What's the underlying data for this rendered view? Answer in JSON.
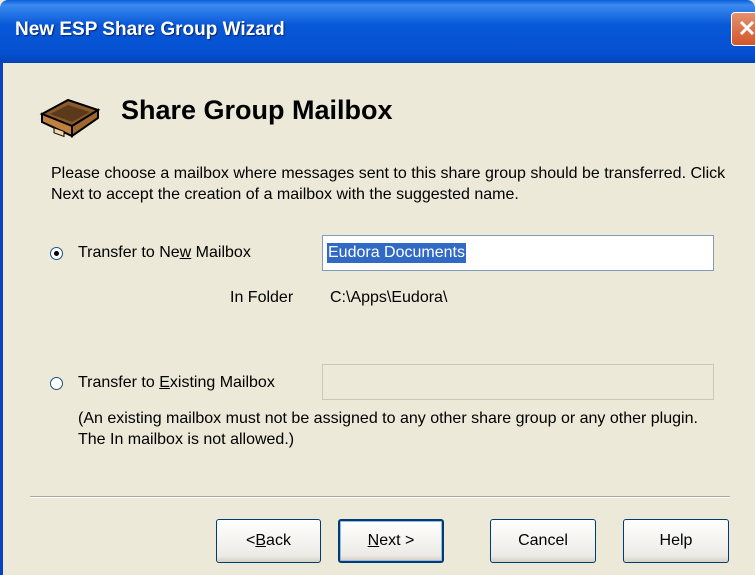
{
  "window": {
    "title": "New ESP Share Group Wizard"
  },
  "header": {
    "title": "Share Group Mailbox",
    "icon": "mailbox-tray-icon"
  },
  "description": "Please choose a mailbox where messages sent to this share group should be transferred. Click Next to accept the creation of a mailbox with the suggested name.",
  "new_mailbox": {
    "label_pre": "Transfer to Ne",
    "label_u": "w",
    "label_post": " Mailbox",
    "selected": true,
    "value": "Eudora Documents",
    "folder_label": "In Folder",
    "folder_value": "C:\\Apps\\Eudora\\"
  },
  "existing_mailbox": {
    "label_pre": "Transfer to ",
    "label_u": "E",
    "label_post": "xisting Mailbox",
    "selected": false,
    "value": "",
    "note": "(An existing mailbox must not be assigned to any other share group or any other plugin. The In mailbox is not allowed.)"
  },
  "buttons": {
    "back_pre": "< ",
    "back_u": "B",
    "back_post": "ack",
    "next_u": "N",
    "next_post": "ext >",
    "cancel": "Cancel",
    "help": "Help"
  }
}
